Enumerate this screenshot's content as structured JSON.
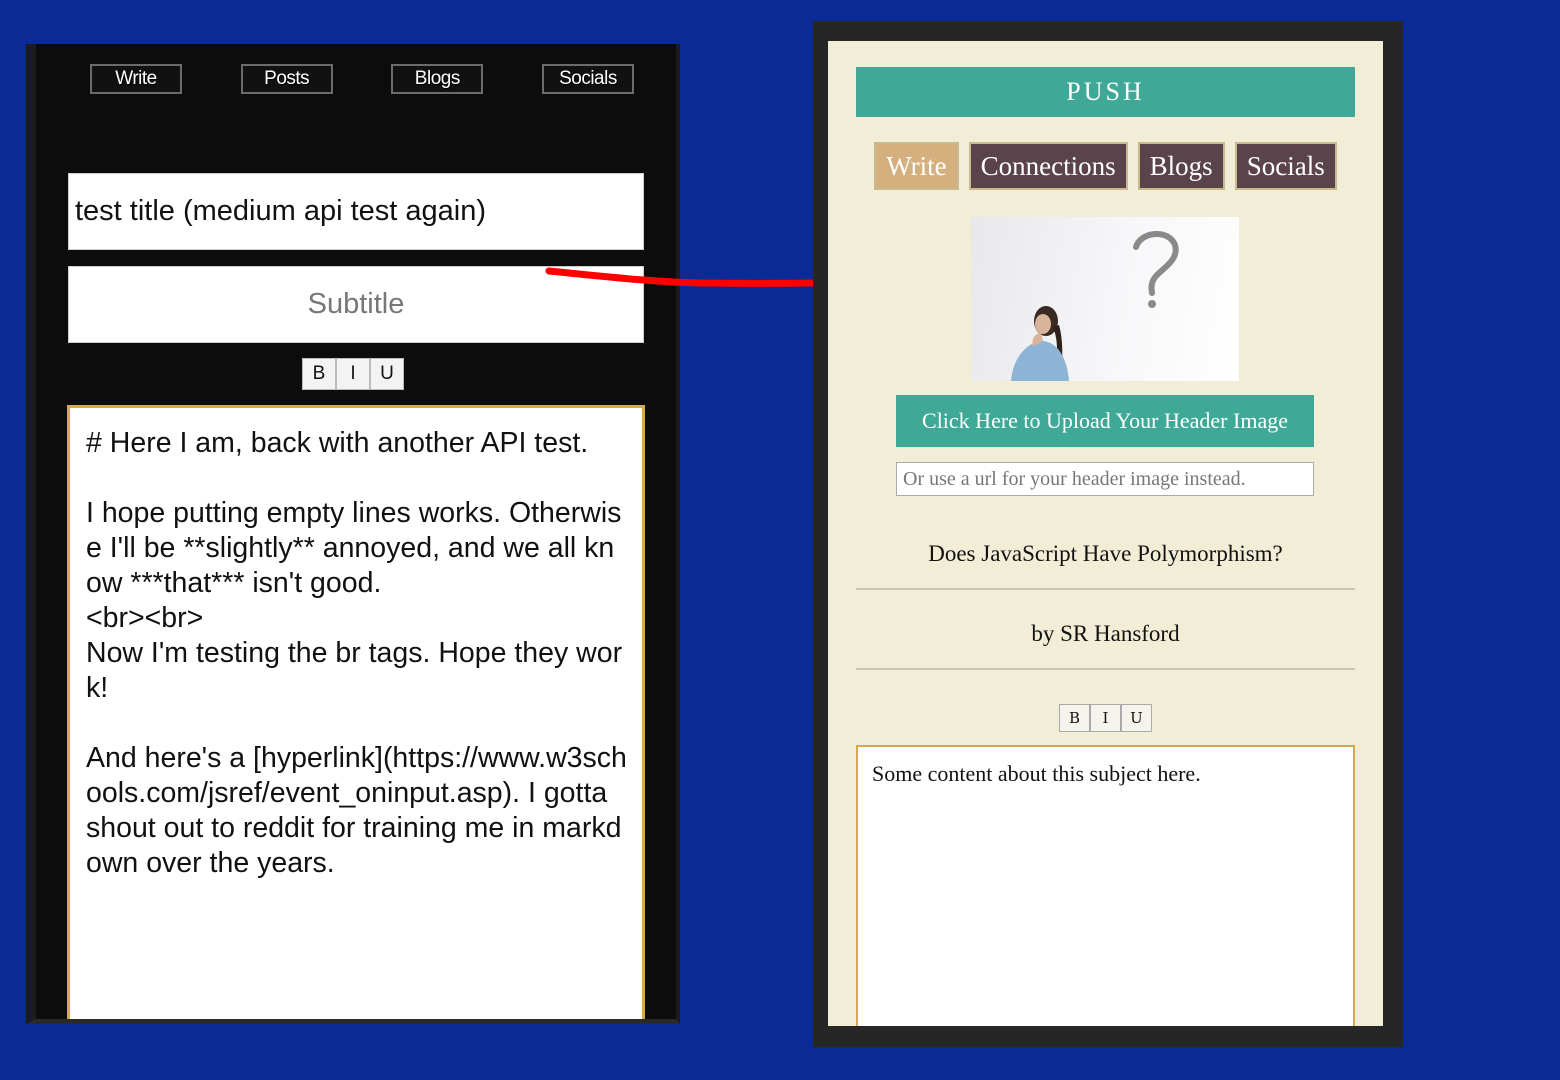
{
  "left": {
    "nav": [
      "Write",
      "Posts",
      "Blogs",
      "Socials"
    ],
    "title_value": "test title (medium api test again)",
    "subtitle_placeholder": "Subtitle",
    "format_buttons": [
      "B",
      "I",
      "U"
    ],
    "editor_text": "# Here I am, back with another API test.\n\nI hope putting empty lines works. Otherwise I'll be **slightly** annoyed, and we all know ***that*** isn't good.\n<br><br>\nNow I'm testing the br tags. Hope they work!\n\nAnd here's a [hyperlink](https://www.w3schools.com/jsref/event_oninput.asp). I gotta shout out to reddit for training me in markdown over the years."
  },
  "right": {
    "brand": "PUSH",
    "nav": [
      "Write",
      "Connections",
      "Blogs",
      "Socials"
    ],
    "active_nav": "Write",
    "upload_label": "Click Here to Upload Your Header Image",
    "url_placeholder": "Or use a url for your header image instead.",
    "post_title": "Does JavaScript Have Polymorphism?",
    "byline": "by SR Hansford",
    "format_buttons": [
      "B",
      "I",
      "U"
    ],
    "editor_text": "Some content about this subject here."
  },
  "colors": {
    "page_bg": "#0a2a96",
    "accent_teal": "#3fa897",
    "nav_plum": "#5a434a",
    "nav_active_tan": "#d5b07f",
    "arrow_red": "#ff0000"
  }
}
